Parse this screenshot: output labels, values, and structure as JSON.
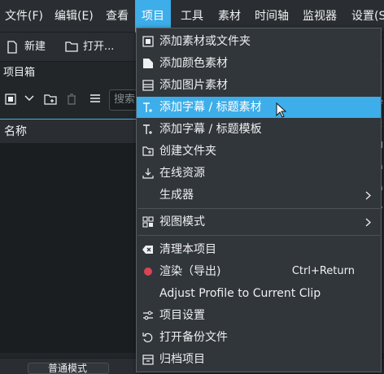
{
  "menubar": {
    "items": [
      "文件(F)",
      "编辑(E)",
      "查看",
      "项目",
      "工具",
      "素材",
      "时间轴",
      "监视器",
      "设置(S)"
    ],
    "active_index": 3
  },
  "toolbar": {
    "new_label": "新建",
    "open_label": "打开..."
  },
  "project_bin": {
    "title": "项目箱",
    "search_placeholder": "搜索",
    "column_name": "名称"
  },
  "right_fragments": [
    "e",
    "c",
    "d",
    "ā",
    "a",
    "y"
  ],
  "status": {
    "mode_label": "普通模式"
  },
  "menu": {
    "items": [
      {
        "label": "添加素材或文件夹",
        "icon": "add-clip-icon",
        "shortcut": "",
        "submenu": false
      },
      {
        "label": "添加颜色素材",
        "icon": "color-clip-icon",
        "shortcut": "",
        "submenu": false
      },
      {
        "label": "添加图片素材",
        "icon": "image-clip-icon",
        "shortcut": "",
        "submenu": false
      },
      {
        "label": "添加字幕 / 标题素材",
        "icon": "title-clip-icon",
        "shortcut": "",
        "submenu": false
      },
      {
        "label": "添加字幕 / 标题模板",
        "icon": "title-template-icon",
        "shortcut": "",
        "submenu": false
      },
      {
        "label": "创建文件夹",
        "icon": "folder-new-icon",
        "shortcut": "",
        "submenu": false
      },
      {
        "label": "在线资源",
        "icon": "download-icon",
        "shortcut": "",
        "submenu": false
      },
      {
        "label": "生成器",
        "icon": "",
        "shortcut": "",
        "submenu": true
      },
      {
        "label": "视图模式",
        "icon": "view-mode-icon",
        "shortcut": "",
        "submenu": true
      },
      {
        "label": "清理本项目",
        "icon": "clear-icon",
        "shortcut": "",
        "submenu": false
      },
      {
        "label": "渲染（导出)",
        "icon": "render-icon",
        "shortcut": "Ctrl+Return",
        "submenu": false
      },
      {
        "label": "Adjust Profile to Current Clip",
        "icon": "",
        "shortcut": "",
        "submenu": false
      },
      {
        "label": "项目设置",
        "icon": "settings-icon",
        "shortcut": "",
        "submenu": false
      },
      {
        "label": "打开备份文件",
        "icon": "backup-icon",
        "shortcut": "",
        "submenu": false
      },
      {
        "label": "归档项目",
        "icon": "archive-icon",
        "shortcut": "",
        "submenu": false
      }
    ],
    "highlighted_index": 3
  },
  "colors": {
    "accent": "#3daee9",
    "menu_bg": "#31363b",
    "window_bg": "#2a2e32",
    "render_dot": "#da4453"
  }
}
